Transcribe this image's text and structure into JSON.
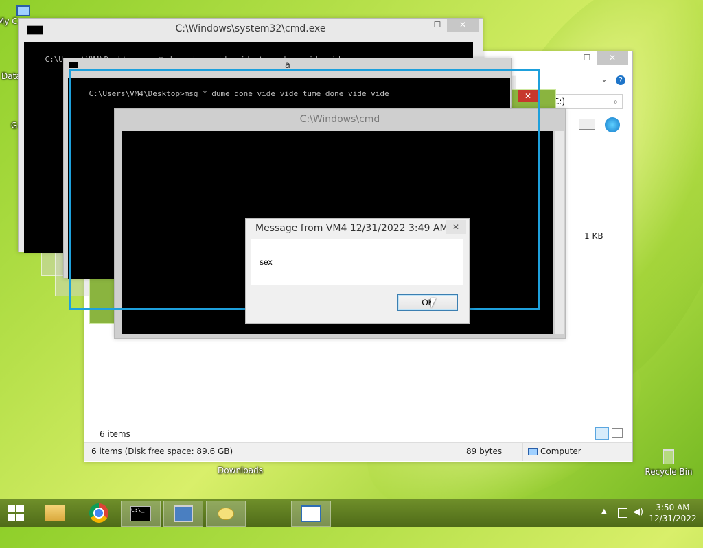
{
  "desktop": {
    "icons": [
      {
        "label": "My C",
        "icon": "computer-icon"
      },
      {
        "label": "Data",
        "icon": "folder-icon"
      },
      {
        "label": "G",
        "icon": "app-icon"
      },
      {
        "label": "Downloads",
        "icon": "downloads-folder-icon"
      },
      {
        "label": "Recycle Bin",
        "icon": "recycle-bin-icon"
      }
    ]
  },
  "cmd_main": {
    "title": "C:\\Windows\\system32\\cmd.exe",
    "line": "C:\\Users\\VM4\\Desktop>msg * dume done vide vide tume done vide vide"
  },
  "cmd_second": {
    "title": "a",
    "line": "C:\\Users\\VM4\\Desktop>msg * dume done vide vide tume done vide vide"
  },
  "cmd_third": {
    "title": "C:\\Windows\\cmd"
  },
  "explorer": {
    "search_text": "C:)",
    "size_label": "1 KB",
    "items_count": "6 items",
    "status_left": "6 items (Disk free space: 89.6 GB)",
    "status_mid": "89 bytes",
    "status_right": "Computer"
  },
  "dialog": {
    "title": "Message from VM4 12/31/2022 3:49 AM",
    "message": "sex",
    "ok_label": "OK"
  },
  "taskbar": {
    "time": "3:50 AM",
    "date": "12/31/2022",
    "items": [
      {
        "name": "start",
        "icon": "windows-start-icon"
      },
      {
        "name": "file-explorer",
        "icon": "file-explorer-icon"
      },
      {
        "name": "chrome",
        "icon": "chrome-icon"
      },
      {
        "name": "cmd",
        "icon": "cmd-icon"
      },
      {
        "name": "network-tool",
        "icon": "network-computer-icon"
      },
      {
        "name": "messenger",
        "icon": "chat-icon"
      },
      {
        "name": "window-app",
        "icon": "app-window-icon"
      }
    ]
  },
  "colors": {
    "selection_border": "#1ea0dc",
    "console_bg": "#000000",
    "close_red": "#c7372d"
  }
}
